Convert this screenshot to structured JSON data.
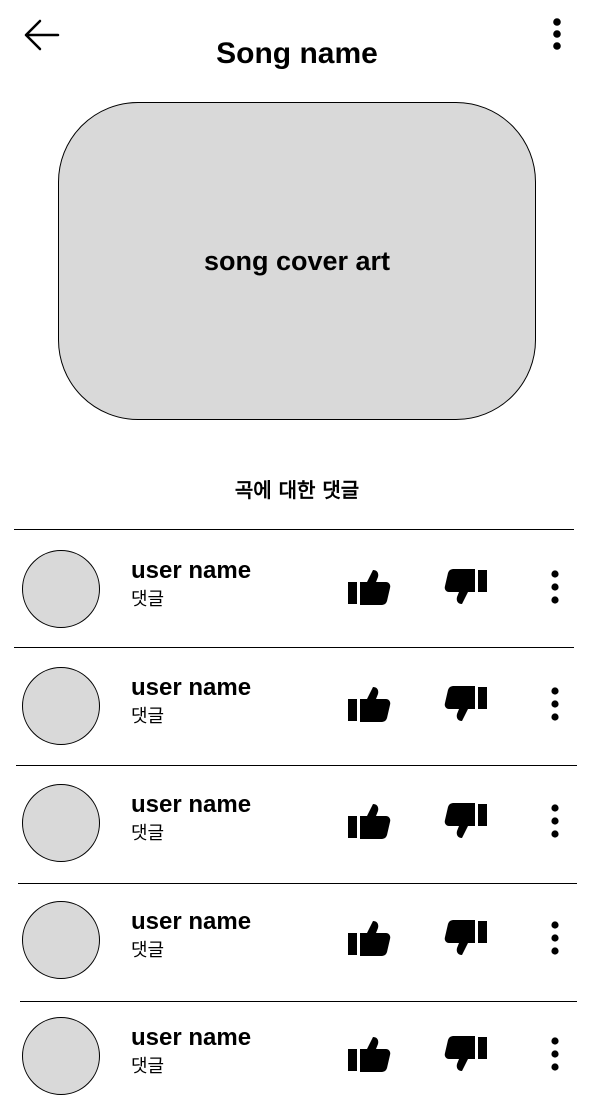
{
  "header": {
    "title": "Song name",
    "back_icon": "arrow-left-icon",
    "more_icon": "more-vertical-icon"
  },
  "cover": {
    "label": "song cover art"
  },
  "comments_section": {
    "title": "곡에 대한 댓글",
    "items": [
      {
        "user": "user name",
        "text": "댓글"
      },
      {
        "user": "user name",
        "text": "댓글"
      },
      {
        "user": "user name",
        "text": "댓글"
      },
      {
        "user": "user name",
        "text": "댓글"
      },
      {
        "user": "user name",
        "text": "댓글"
      }
    ],
    "icons": {
      "like": "thumbs-up-icon",
      "dislike": "thumbs-down-icon",
      "more": "more-vertical-icon"
    }
  },
  "colors": {
    "placeholder_fill": "#d9d9d9",
    "stroke": "#000000",
    "background": "#ffffff"
  }
}
